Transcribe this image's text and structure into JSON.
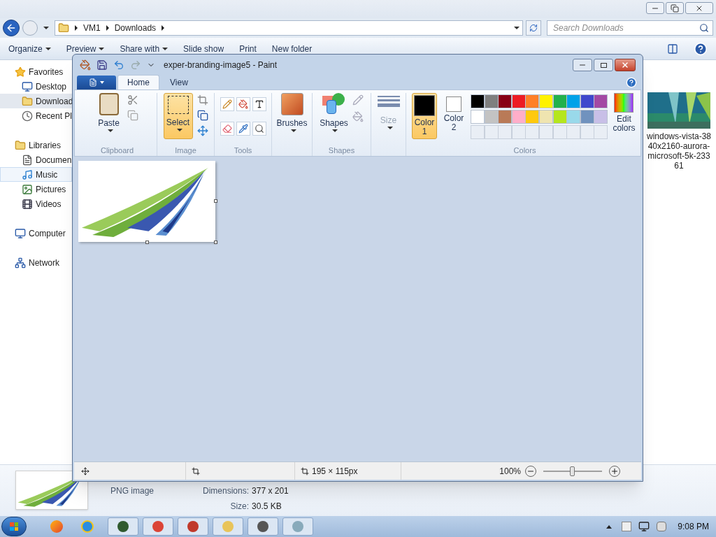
{
  "explorer": {
    "address": [
      "VM1",
      "Downloads"
    ],
    "search": {
      "placeholder": "Search Downloads"
    },
    "commands": [
      {
        "label": "Organize",
        "dropdown": true
      },
      {
        "label": "Preview",
        "dropdown": true
      },
      {
        "label": "Share with",
        "dropdown": true
      },
      {
        "label": "Slide show",
        "dropdown": false
      },
      {
        "label": "Print",
        "dropdown": false
      },
      {
        "label": "New folder",
        "dropdown": false
      }
    ],
    "sidebar": [
      {
        "label": "Favorites",
        "selected": false,
        "hovered": false,
        "children": [
          {
            "label": "Desktop",
            "selected": false,
            "hovered": false
          },
          {
            "label": "Download",
            "selected": true,
            "hovered": false
          },
          {
            "label": "Recent Pl",
            "selected": false,
            "hovered": false
          }
        ]
      },
      {
        "label": "Libraries",
        "selected": false,
        "hovered": false,
        "children": [
          {
            "label": "Documen",
            "selected": false,
            "hovered": false
          },
          {
            "label": "Music",
            "selected": false,
            "hovered": true
          },
          {
            "label": "Pictures",
            "selected": false,
            "hovered": false
          },
          {
            "label": "Videos",
            "selected": false,
            "hovered": false
          }
        ]
      },
      {
        "label": "Computer",
        "selected": false,
        "hovered": false
      },
      {
        "label": "Network",
        "selected": false,
        "hovered": false
      }
    ],
    "file": {
      "name_lines": [
        "windows-vista-38",
        "40x2160-aurora-",
        "microsoft-5k-233",
        "61"
      ]
    },
    "details": {
      "type": "PNG image",
      "fields": [
        {
          "label": "Dimensions:",
          "value": "377 x 201"
        },
        {
          "label": "Size:",
          "value": "30.5 KB"
        }
      ]
    },
    "taskbar": {
      "time": "9:08 PM"
    }
  },
  "paint": {
    "title": "exper-branding-image5 - Paint",
    "tabs": [
      {
        "label": "Home",
        "selected": true
      },
      {
        "label": "View",
        "selected": false
      }
    ],
    "ribbon": {
      "paste": "Paste",
      "select": {
        "label": "Select",
        "selected": true
      },
      "brushes": "Brushes",
      "shapes": "Shapes",
      "size": {
        "label": "Size",
        "disabled": true
      },
      "color1": {
        "label": "Color 1",
        "selected": true,
        "color": "#000000"
      },
      "color2": {
        "label": "Color 2",
        "selected": false,
        "color": "#ffffff"
      },
      "edit_colors": "Edit colors",
      "group_labels": {
        "clipboard": "Clipboard",
        "image": "Image",
        "tools": "Tools",
        "shapes": "Shapes",
        "colors": "Colors"
      }
    },
    "palette": [
      {
        "color": "#000000"
      },
      {
        "color": "#7f7f7f"
      },
      {
        "color": "#880015"
      },
      {
        "color": "#ed1c24"
      },
      {
        "color": "#ff7f27"
      },
      {
        "color": "#fff200"
      },
      {
        "color": "#22b14c"
      },
      {
        "color": "#00a2e8"
      },
      {
        "color": "#3f48cc"
      },
      {
        "color": "#a349a4"
      },
      {
        "color": "#ffffff"
      },
      {
        "color": "#c3c3c3"
      },
      {
        "color": "#b97a57"
      },
      {
        "color": "#ffaec9"
      },
      {
        "color": "#ffc90e"
      },
      {
        "color": "#efe4b0"
      },
      {
        "color": "#b5e61d"
      },
      {
        "color": "#99d9ea"
      },
      {
        "color": "#7092be"
      },
      {
        "color": "#c8bfe7"
      }
    ],
    "status": {
      "size": "195 × 115px",
      "zoom": "100%",
      "zoom_slider": {
        "level": 0.5
      }
    }
  }
}
